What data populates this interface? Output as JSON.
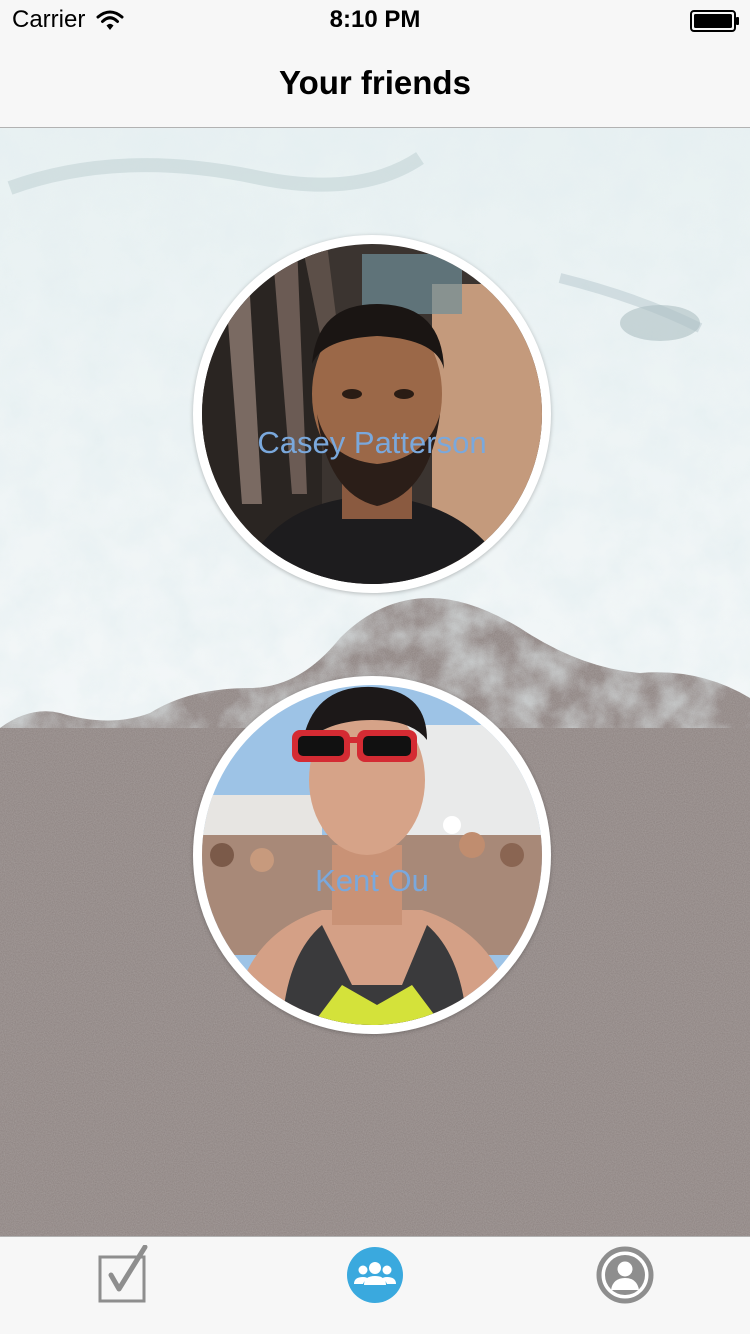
{
  "status_bar": {
    "carrier": "Carrier",
    "time": "8:10 PM"
  },
  "nav": {
    "title": "Your friends"
  },
  "friends": [
    {
      "name": "Casey Patterson"
    },
    {
      "name": "Kent Ou"
    }
  ],
  "tab_bar": {
    "tabs": [
      {
        "icon": "checkbox-icon",
        "selected": false
      },
      {
        "icon": "friends-group-icon",
        "selected": true
      },
      {
        "icon": "profile-icon",
        "selected": false
      }
    ]
  },
  "colors": {
    "friend_name": "#7aa8dc",
    "tab_selected": "#3aa9de",
    "tab_unselected": "#8e8e8e",
    "bar_background": "#f7f7f7"
  }
}
